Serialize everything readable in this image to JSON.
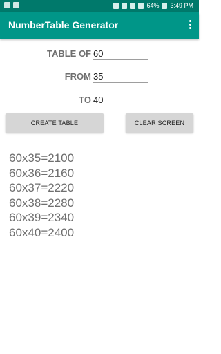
{
  "status_bar": {
    "battery": "64%",
    "time": "3:49 PM",
    "icons": [
      "image-icon",
      "message-icon",
      "mute-icon",
      "wifi-icon",
      "sim-icon",
      "signal-icon",
      "battery-icon"
    ]
  },
  "app_bar": {
    "title": "NumberTable Generator",
    "menu_icon": "more-vert-icon"
  },
  "form": {
    "table_of": {
      "label": "TABLE OF",
      "value": "60"
    },
    "from": {
      "label": "FROM",
      "value": "35"
    },
    "to": {
      "label": "TO",
      "value": "40"
    }
  },
  "buttons": {
    "create": "CREATE TABLE",
    "clear": "CLEAR SCREEN"
  },
  "results": [
    "60x35=2100",
    "60x36=2160",
    "60x37=2220",
    "60x38=2280",
    "60x39=2340",
    "60x40=2400"
  ],
  "colors": {
    "primary": "#009688",
    "primary_dark": "#00796b",
    "accent": "#e91e63"
  }
}
